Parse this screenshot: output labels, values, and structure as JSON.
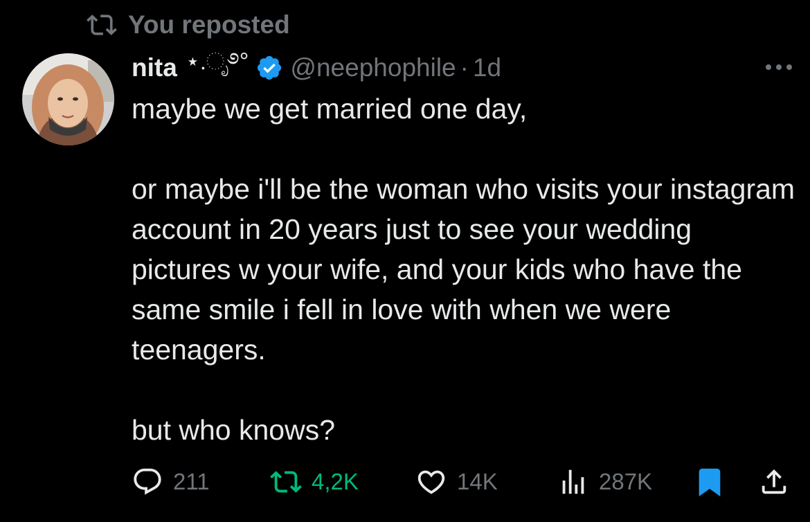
{
  "repost": {
    "label": "You reposted",
    "icon": "repost-icon"
  },
  "author": {
    "name": "nita",
    "name_decoration": "⋆.ೃ࿔°",
    "verified": true,
    "handle": "@neephophile",
    "separator": "·",
    "time": "1d",
    "avatar_icon": "avatar"
  },
  "tweet": {
    "paragraphs": [
      "maybe we get married one day,",
      "or maybe i'll be the woman who visits your instagram account in 20 years just to see your wedding pictures w your wife, and your kids who have the same smile i fell in love with when we were teenagers.",
      "but who knows?"
    ]
  },
  "actions": {
    "replies": "211",
    "reposts": "4,2K",
    "likes": "14K",
    "views": "287K",
    "bookmarked": true
  },
  "colors": {
    "background": "#000000",
    "text": "#e7e9ea",
    "muted": "#71767b",
    "repost_active": "#00ba7c",
    "bookmark_active": "#1d9bf0",
    "verified": "#1d9bf0"
  }
}
